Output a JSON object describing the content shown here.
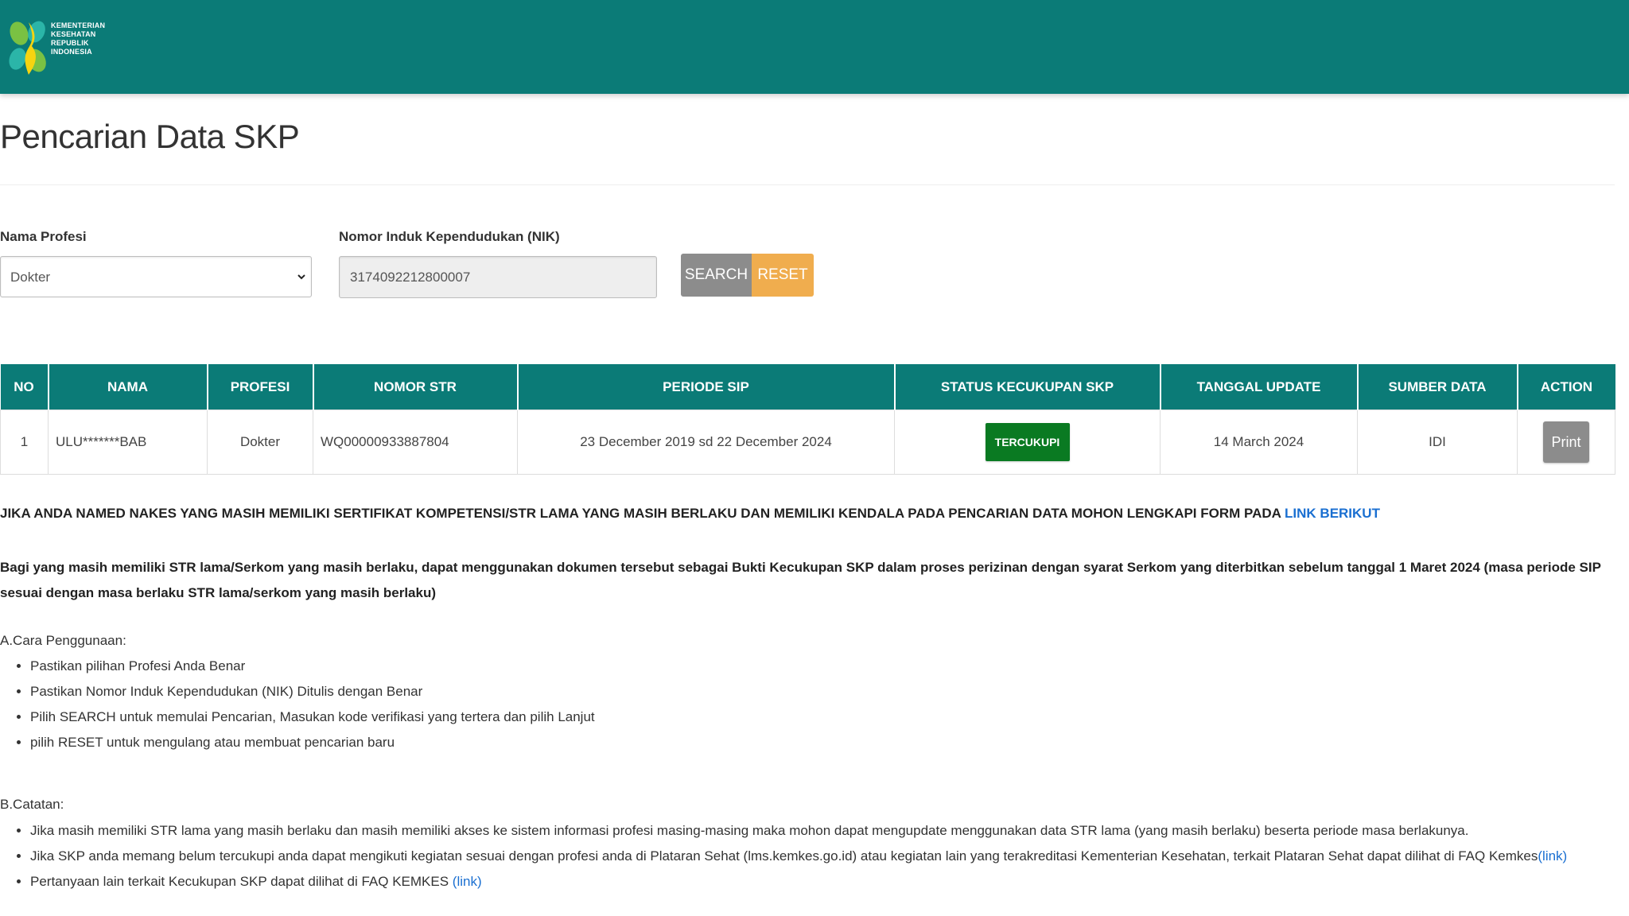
{
  "header": {
    "logo_lines": [
      "KEMENTERIAN",
      "KESEHATAN",
      "REPUBLIK",
      "INDONESIA"
    ],
    "logo_colors": [
      "#7ac143",
      "#f6d410",
      "#2bb5a8"
    ]
  },
  "page_title": "Pencarian Data SKP",
  "form": {
    "profesi_label": "Nama Profesi",
    "profesi_value": "Dokter",
    "nik_label": "Nomor Induk Kependudukan (NIK)",
    "nik_value": "3174092212800007",
    "search_label": "SEARCH",
    "reset_label": "RESET"
  },
  "table": {
    "headers": [
      "NO",
      "NAMA",
      "PROFESI",
      "NOMOR STR",
      "PERIODE SIP",
      "STATUS KECUKUPAN SKP",
      "TANGGAL UPDATE",
      "SUMBER DATA",
      "ACTION"
    ],
    "rows": [
      {
        "no": "1",
        "nama": "ULU*******BAB",
        "profesi": "Dokter",
        "nomor_str": "WQ00000933887804",
        "periode_sip": "23 December 2019 sd 22 December 2024",
        "status": "TERCUKUPI",
        "tanggal_update": "14 March 2024",
        "sumber_data": "IDI",
        "action": "Print"
      }
    ]
  },
  "notice": {
    "text": "JIKA ANDA NAMED NAKES YANG MASIH MEMILIKI SERTIFIKAT KOMPETENSI/STR LAMA YANG MASIH BERLAKU DAN MEMILIKI KENDALA PADA PENCARIAN DATA MOHON LENGKAPI FORM PADA ",
    "link": "LINK BERIKUT"
  },
  "paragraph": "Bagi yang masih memiliki STR lama/Serkom yang masih berlaku, dapat menggunakan dokumen tersebut sebagai Bukti Kecukupan SKP dalam proses perizinan dengan syarat Serkom yang diterbitkan sebelum tanggal 1 Maret 2024 (masa periode SIP sesuai dengan masa berlaku STR lama/serkom yang masih berlaku)",
  "cara": {
    "title": "A.Cara Penggunaan:",
    "items": [
      "Pastikan pilihan Profesi Anda Benar",
      "Pastikan Nomor Induk Kependudukan (NIK) Ditulis dengan Benar",
      "Pilih SEARCH untuk memulai Pencarian, Masukan kode verifikasi yang tertera dan pilih Lanjut",
      "pilih RESET untuk mengulang atau membuat pencarian baru"
    ]
  },
  "catatan": {
    "title": "B.Catatan:",
    "item1": "Jika masih memiliki STR lama yang masih berlaku dan masih memiliki akses ke sistem informasi profesi masing-masing maka mohon dapat mengupdate menggunakan data STR lama (yang masih berlaku) beserta periode masa berlakunya.",
    "item2_text": "Jika SKP anda memang belum tercukupi anda dapat mengikuti kegiatan sesuai dengan profesi anda di Plataran Sehat (lms.kemkes.go.id) atau kegiatan lain yang terakreditasi Kementerian Kesehatan, terkait Plataran Sehat dapat dilihat di FAQ Kemkes",
    "item2_link": "(link)",
    "item3_text": "Pertanyaan lain terkait Kecukupan SKP dapat dilihat di FAQ KEMKES ",
    "item3_link": "(link)"
  }
}
